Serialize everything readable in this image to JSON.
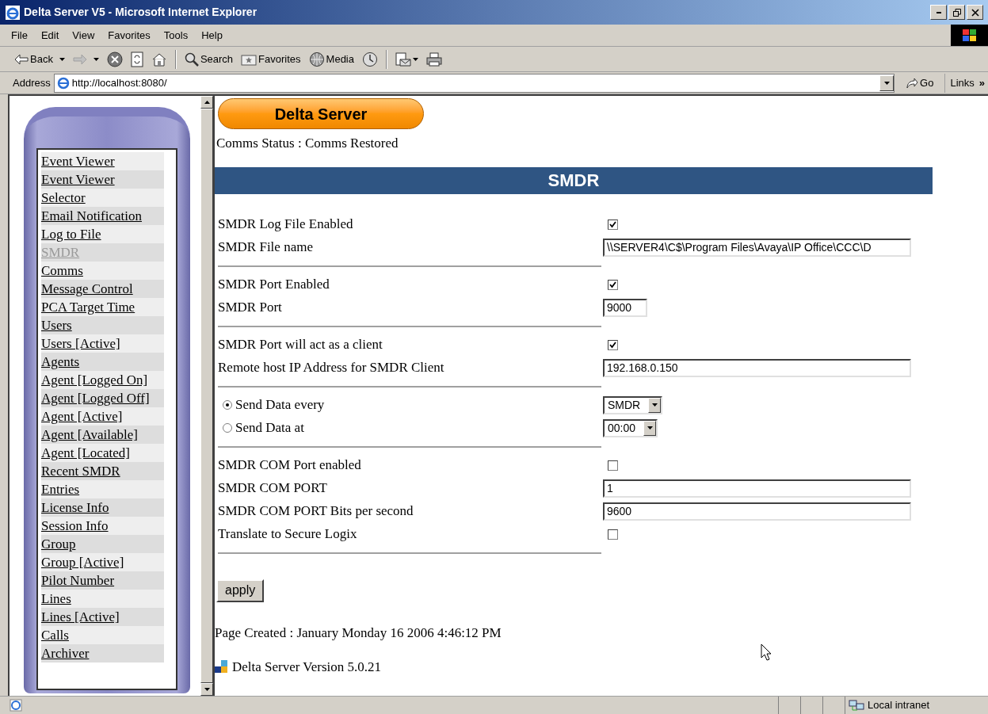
{
  "window": {
    "title": "Delta Server V5 - Microsoft Internet Explorer"
  },
  "menu_bar": [
    "File",
    "Edit",
    "View",
    "Favorites",
    "Tools",
    "Help"
  ],
  "toolbar": [
    {
      "kind": "back",
      "label": "Back"
    },
    {
      "kind": "forward",
      "disabled": true
    },
    {
      "kind": "stop"
    },
    {
      "kind": "refresh"
    },
    {
      "kind": "home"
    },
    {
      "kind": "separator"
    },
    {
      "kind": "search",
      "label": "Search"
    },
    {
      "kind": "favorites",
      "label": "Favorites"
    },
    {
      "kind": "media",
      "label": "Media"
    },
    {
      "kind": "history"
    },
    {
      "kind": "separator"
    },
    {
      "kind": "mail"
    },
    {
      "kind": "print"
    }
  ],
  "address_bar": {
    "label": "Address",
    "url": "http://localhost:8080/",
    "go": "Go",
    "links": "Links",
    "links_more": "»"
  },
  "sidebar": {
    "items": [
      {
        "label": "Event Viewer",
        "selected": false
      },
      {
        "label": "Event Viewer",
        "selected": false
      },
      {
        "label": "Selector",
        "selected": false
      },
      {
        "label": "Email Notification",
        "selected": false
      },
      {
        "label": "Log to File",
        "selected": false
      },
      {
        "label": "SMDR",
        "selected": true
      },
      {
        "label": "Comms",
        "selected": false
      },
      {
        "label": "Message Control",
        "selected": false
      },
      {
        "label": "PCA Target Time",
        "selected": false
      },
      {
        "label": "Users",
        "selected": false
      },
      {
        "label": "Users [Active]",
        "selected": false
      },
      {
        "label": "Agents",
        "selected": false
      },
      {
        "label": "Agent [Logged On]",
        "selected": false
      },
      {
        "label": "Agent [Logged Off]",
        "selected": false
      },
      {
        "label": "Agent [Active]",
        "selected": false
      },
      {
        "label": "Agent [Available]",
        "selected": false
      },
      {
        "label": "Agent [Located]",
        "selected": false
      },
      {
        "label": "Recent SMDR",
        "selected": false
      },
      {
        "label": "Entries",
        "selected": false
      },
      {
        "label": "License Info",
        "selected": false
      },
      {
        "label": "Session Info",
        "selected": false
      },
      {
        "label": "Group",
        "selected": false
      },
      {
        "label": "Group [Active]",
        "selected": false
      },
      {
        "label": "Pilot Number",
        "selected": false
      },
      {
        "label": "Lines",
        "selected": false
      },
      {
        "label": "Lines [Active]",
        "selected": false
      },
      {
        "label": "Calls",
        "selected": false
      },
      {
        "label": "Archiver",
        "selected": false
      }
    ]
  },
  "main": {
    "logo": "Delta Server",
    "comms_status": "Comms Status : Comms Restored",
    "section_title": "SMDR",
    "groups": [
      [
        {
          "kind": "checkbox",
          "label": "SMDR Log File Enabled",
          "checked": true
        },
        {
          "kind": "text",
          "label": "SMDR File name",
          "value": "\\\\SERVER4\\C$\\Program Files\\Avaya\\IP Office\\CCC\\D"
        }
      ],
      [
        {
          "kind": "checkbox",
          "label": "SMDR Port Enabled",
          "checked": true
        },
        {
          "kind": "short_text",
          "label": "SMDR Port",
          "value": "9000"
        }
      ],
      [
        {
          "kind": "checkbox",
          "label": "SMDR Port will act as a client",
          "checked": true
        },
        {
          "kind": "text",
          "label": "Remote host IP Address for SMDR Client",
          "value": "192.168.0.150"
        }
      ],
      [
        {
          "kind": "radio_select",
          "label": "Send Data every",
          "selected": true,
          "value": "SMDR"
        },
        {
          "kind": "radio_select",
          "label": "Send Data at",
          "selected": false,
          "value": "00:00"
        }
      ],
      [
        {
          "kind": "checkbox",
          "label": "SMDR COM Port enabled",
          "checked": false
        },
        {
          "kind": "text",
          "label": "SMDR COM PORT",
          "value": "1"
        },
        {
          "kind": "text",
          "label": "SMDR COM PORT Bits per second",
          "value": "9600"
        },
        {
          "kind": "checkbox",
          "label": "Translate to Secure Logix",
          "checked": false
        }
      ]
    ],
    "apply": "apply",
    "page_created": "Page Created : January Monday 16 2006 4:46:12 PM",
    "version": "Delta Server Version 5.0.21"
  },
  "status_bar": {
    "zone": "Local intranet"
  }
}
